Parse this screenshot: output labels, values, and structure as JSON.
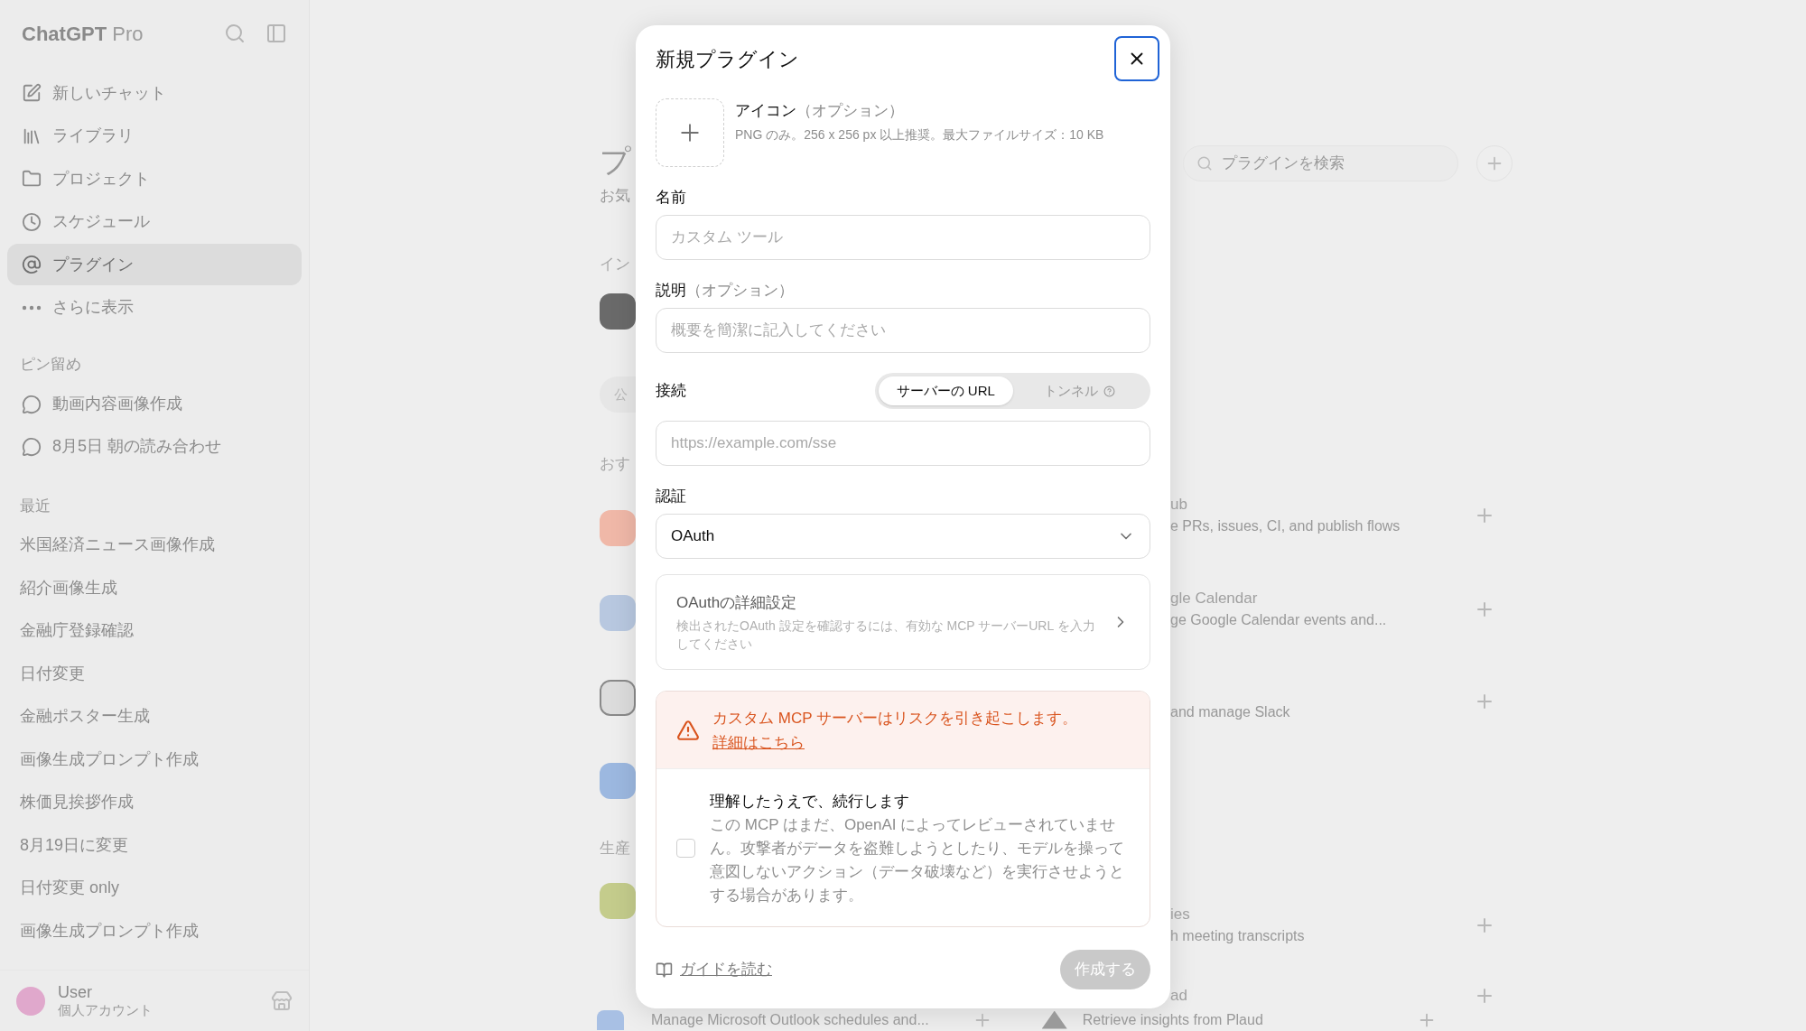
{
  "sidebar": {
    "brand": "ChatGPT",
    "plan": "Pro",
    "nav": [
      {
        "label": "新しいチャット",
        "selected": false
      },
      {
        "label": "ライブラリ",
        "selected": false
      },
      {
        "label": "プロジェクト",
        "selected": false
      },
      {
        "label": "スケジュール",
        "selected": false
      },
      {
        "label": "プラグイン",
        "selected": true
      },
      {
        "label": "さらに表示",
        "selected": false
      }
    ],
    "pinned_header": "ピン留め",
    "pinned": [
      "動画内容画像作成",
      "8月5日 朝の読み合わせ"
    ],
    "recent_header": "最近",
    "recent": [
      "米国経済ニュース画像作成",
      "紹介画像生成",
      "金融庁登録確認",
      "日付変更",
      "金融ポスター生成",
      "画像生成プロンプト作成",
      "株価見挨拶作成",
      "8月19日に変更",
      "日付変更 only",
      "画像生成プロンプト作成"
    ],
    "user": {
      "name": "User",
      "plan": "個人アカウント"
    }
  },
  "background": {
    "left": {
      "title": "プ",
      "subtitle": "お気",
      "section_1": "イン",
      "chip": "公",
      "section_2": "おす",
      "section_3": "生産"
    },
    "right": {
      "search_placeholder": "プラグインを検索",
      "rows": [
        {
          "title": "ub",
          "description": "e PRs, issues, CI, and publish flows"
        },
        {
          "title": "gle Calendar",
          "description": "ge Google Calendar events and..."
        },
        {
          "description": "and manage Slack"
        },
        {
          "title": "ies",
          "description": "h meeting transcripts"
        },
        {
          "title": "ad"
        }
      ]
    },
    "bottom": [
      "Manage Microsoft Outlook schedules and...",
      "Retrieve insights from Plaud"
    ]
  },
  "dialog": {
    "title": "新規プラグイン",
    "icon_field": {
      "label": "アイコン",
      "optional": "（オプション）",
      "hint": "PNG のみ。256 x 256 px 以上推奨。最大ファイルサイズ：10 KB"
    },
    "name_field": {
      "label": "名前",
      "placeholder": "カスタム ツール"
    },
    "description_field": {
      "label": "説明",
      "optional": "（オプション）",
      "placeholder": "概要を簡潔に記入してください"
    },
    "connection": {
      "label": "接続",
      "options": [
        {
          "label": "サーバーの URL",
          "selected": true
        },
        {
          "label": "トンネル",
          "selected": false
        }
      ],
      "placeholder": "https://example.com/sse"
    },
    "auth": {
      "label": "認証",
      "value": "OAuth"
    },
    "oauth_details": {
      "title": "OAuthの詳細設定",
      "description": "検出されたOAuth 設定を確認するには、有効な MCP サーバーURL を入力してください"
    },
    "warning": {
      "text": "カスタム MCP サーバーはリスクを引き起こします。",
      "link": "詳細はこちら"
    },
    "acknowledge": {
      "checked": false,
      "title": "理解したうえで、続行します",
      "text": "この MCP はまだ、OpenAI によってレビューされていません。攻撃者がデータを盗難しようとしたり、モデルを操って意図しないアクション（データ破壊など）を実行させようとする場合があります。"
    },
    "footer": {
      "guide_link": "ガイドを読む",
      "create_button": {
        "label": "作成する",
        "disabled": true
      }
    }
  }
}
